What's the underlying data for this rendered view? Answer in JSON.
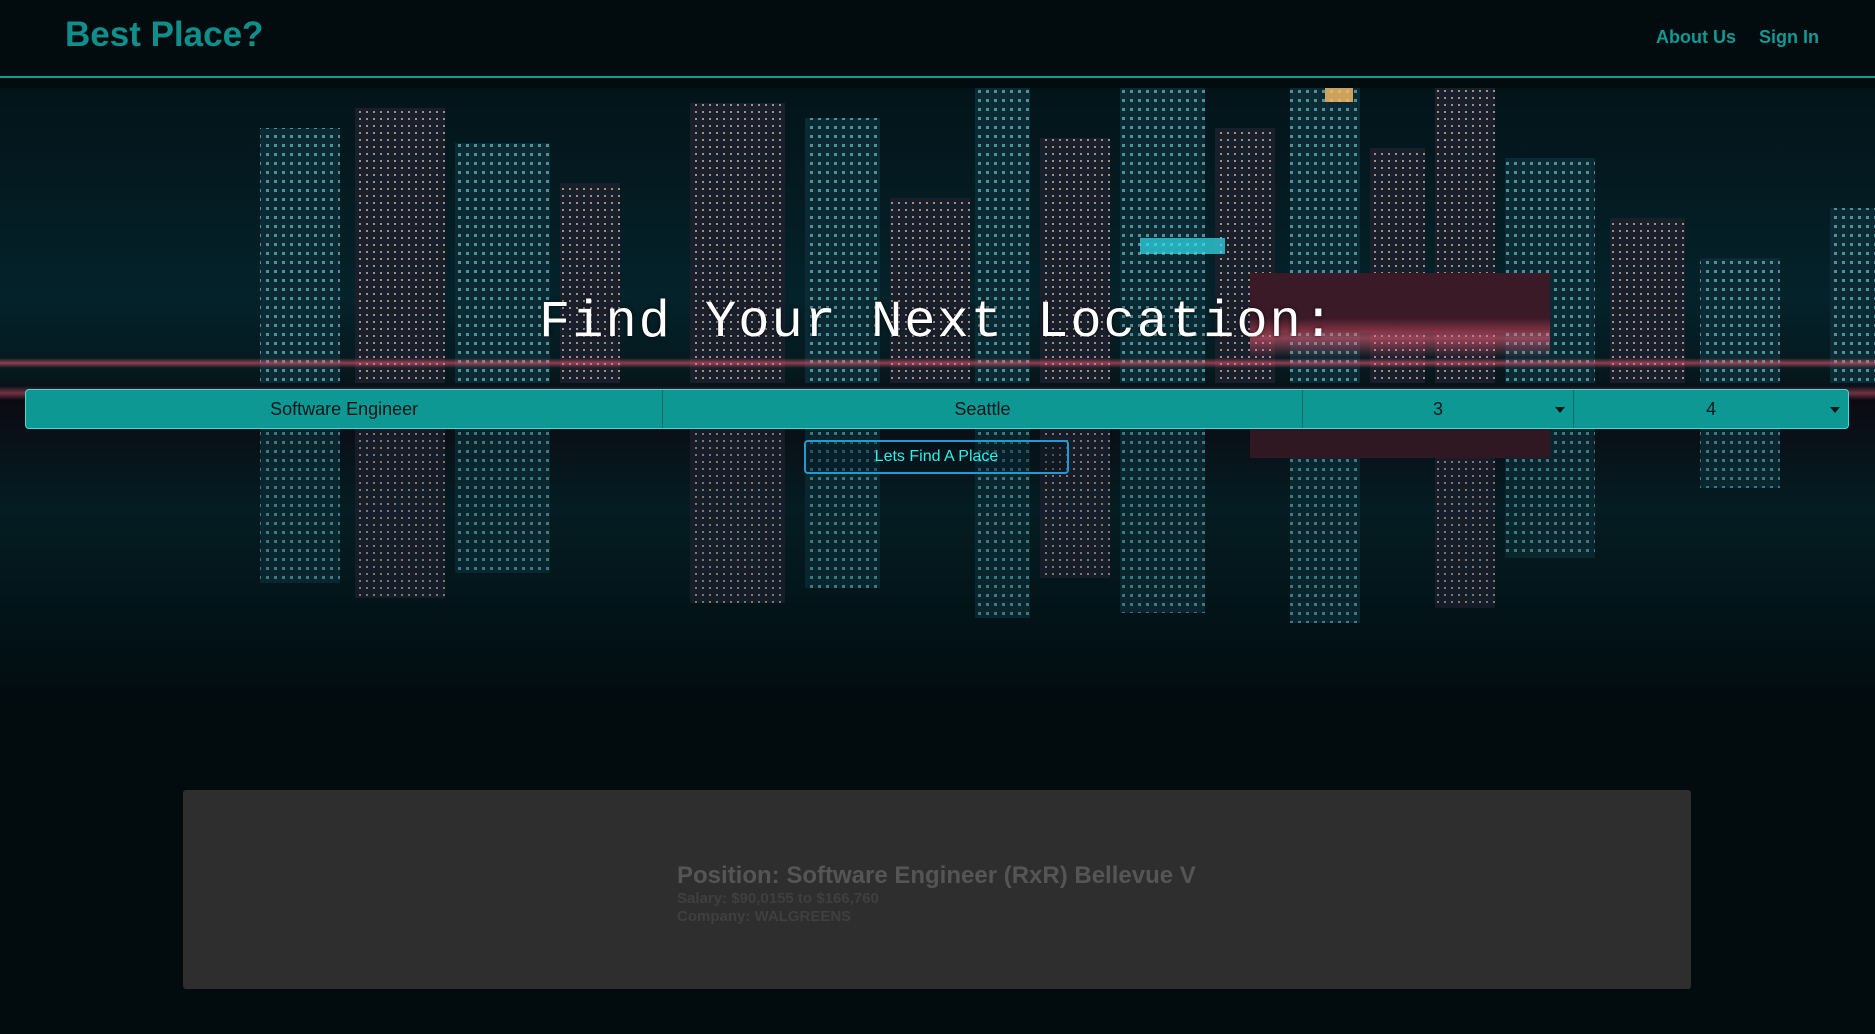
{
  "header": {
    "brand": "Best Place?",
    "nav": {
      "about": "About Us",
      "signin": "Sign In"
    }
  },
  "hero": {
    "headline": "Find Your Next Location:",
    "fields": {
      "job": "Software Engineer",
      "city": "Seattle",
      "select_one": "3",
      "select_two": "4"
    },
    "button": "Lets Find A Place"
  },
  "result": {
    "position": "Position: Software Engineer (RxR) Bellevue V",
    "salary": "Salary: $90,0155 to $166,760",
    "company": "Company: WALGREENS"
  },
  "colors": {
    "accent": "#0e9893",
    "brand": "#0f8f8b",
    "button_text": "#29f2e8",
    "background": "#020b0e",
    "card": "#2e2e2e"
  }
}
